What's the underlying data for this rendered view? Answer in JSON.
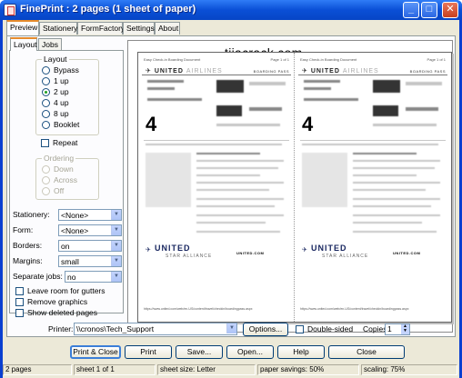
{
  "window": {
    "title": "FinePrint : 2 pages (1 sheet of paper)"
  },
  "tabs": [
    "Preview",
    "Stationery",
    "FormFactory",
    "Settings",
    "About"
  ],
  "sub_tabs": [
    "Layout",
    "Jobs"
  ],
  "layout": {
    "legend": "Layout",
    "options": [
      "Bypass",
      "1 up",
      "2 up",
      "4 up",
      "8 up",
      "Booklet"
    ],
    "selected": "2 up",
    "repeat_label": "Repeat"
  },
  "ordering": {
    "legend": "Ordering",
    "options": [
      "Down",
      "Across",
      "Off"
    ]
  },
  "fields": {
    "stationery": {
      "label": "Stationery:",
      "value": "<None>"
    },
    "form": {
      "label": "Form:",
      "value": "<None>"
    },
    "borders": {
      "label": "Borders:",
      "value": "on"
    },
    "margins": {
      "label": "Margins:",
      "value": "small"
    },
    "separate_jobs": {
      "label": "Separate jobs:",
      "value": "no"
    }
  },
  "checkboxes": {
    "leave_room": "Leave room for gutters",
    "remove_graphics": "Remove graphics",
    "show_deleted": "Show deleted pages"
  },
  "preview": {
    "watermark": "tijacrack.com",
    "header_left": "Easy Check-in Boarding Document",
    "header_right": "Page 1 of 1",
    "logo": "UNITED",
    "logo_suffix": "AIRLINES",
    "boarding_pass": "BOARDING PASS",
    "gate": "4",
    "united_sub": "STAR ALLIANCE",
    "united_url": "UNITED.COM",
    "footer_url": "https://www.united.com/web/en-US/content/travel/checkin/boardingpass.aspx"
  },
  "printer": {
    "label": "Printer:",
    "value": "\\\\cronos\\Tech_Support",
    "options_button": "Options...",
    "double_sided": "Double-sided",
    "copies_label": "Copies",
    "copies": "1"
  },
  "buttons": {
    "print_close": "Print & Close",
    "print": "Print",
    "save": "Save...",
    "open": "Open...",
    "help": "Help",
    "close": "Close"
  },
  "status": {
    "pages": "2 pages",
    "sheet": "sheet 1 of 1",
    "sheet_size": "sheet size: Letter",
    "paper_savings": "paper savings: 50%",
    "scaling": "scaling: 75%"
  }
}
